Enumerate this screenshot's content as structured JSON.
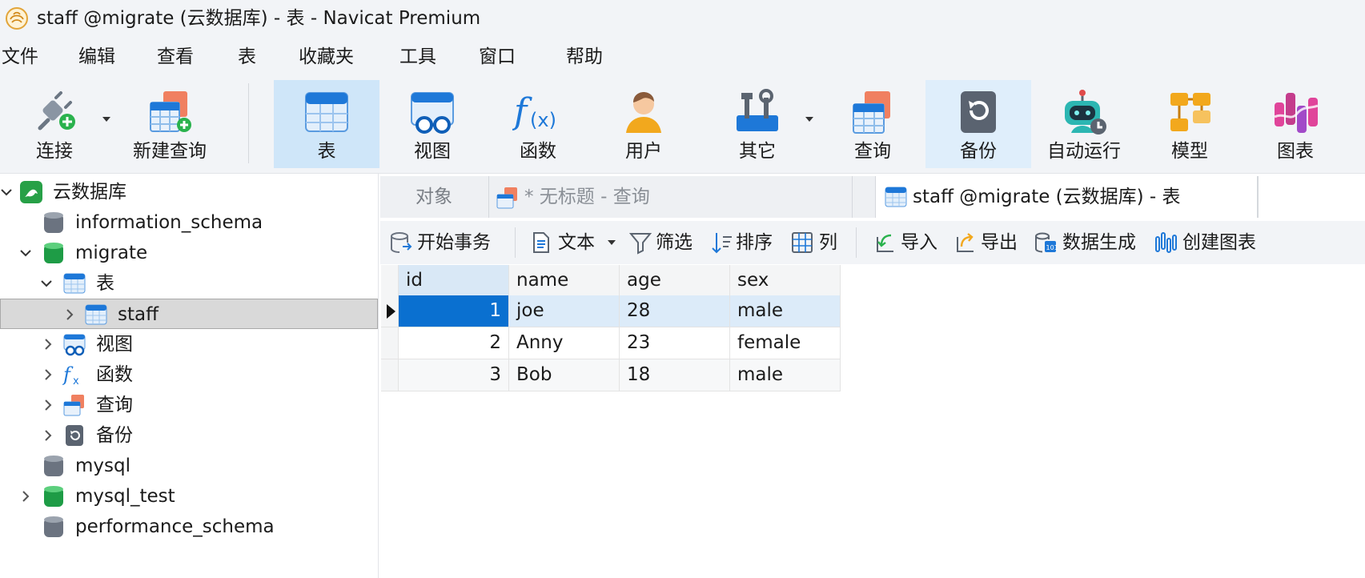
{
  "window": {
    "title": "staff @migrate (云数据库) - 表 - Navicat Premium"
  },
  "menu": [
    "文件",
    "编辑",
    "查看",
    "表",
    "收藏夹",
    "工具",
    "窗口",
    "帮助"
  ],
  "toolbar": {
    "connect": "连接",
    "new_query": "新建查询",
    "table": "表",
    "view": "视图",
    "function": "函数",
    "user": "用户",
    "other": "其它",
    "query": "查询",
    "backup": "备份",
    "automation": "自动运行",
    "model": "模型",
    "chart": "图表"
  },
  "tree": {
    "connection": "云数据库",
    "nodes": {
      "information_schema": "information_schema",
      "migrate": "migrate",
      "tables": "表",
      "staff": "staff",
      "views": "视图",
      "functions": "函数",
      "queries": "查询",
      "backups": "备份",
      "mysql": "mysql",
      "mysql_test": "mysql_test",
      "performance_schema": "performance_schema"
    }
  },
  "tabs": {
    "objects": "对象",
    "untitled_query": "* 无标题 - 查询",
    "staff_table": "staff @migrate (云数据库) - 表"
  },
  "object_toolbar": {
    "begin_transaction": "开始事务",
    "text": "文本",
    "filter": "筛选",
    "sort": "排序",
    "columns": "列",
    "import": "导入",
    "export": "导出",
    "data_generation": "数据生成",
    "create_chart": "创建图表"
  },
  "table": {
    "columns": [
      "id",
      "name",
      "age",
      "sex"
    ],
    "rows": [
      [
        "1",
        "joe",
        "28",
        "male"
      ],
      [
        "2",
        "Anny",
        "23",
        "female"
      ],
      [
        "3",
        "Bob",
        "18",
        "male"
      ]
    ],
    "selected_row": 1
  },
  "colors": {
    "accent": "#0a70d0",
    "selected_cell": "#0a70d0",
    "selected_row": "#dcebf9",
    "toolbar_active": "#cfe6f9",
    "chrome": "#f2f4f7"
  }
}
